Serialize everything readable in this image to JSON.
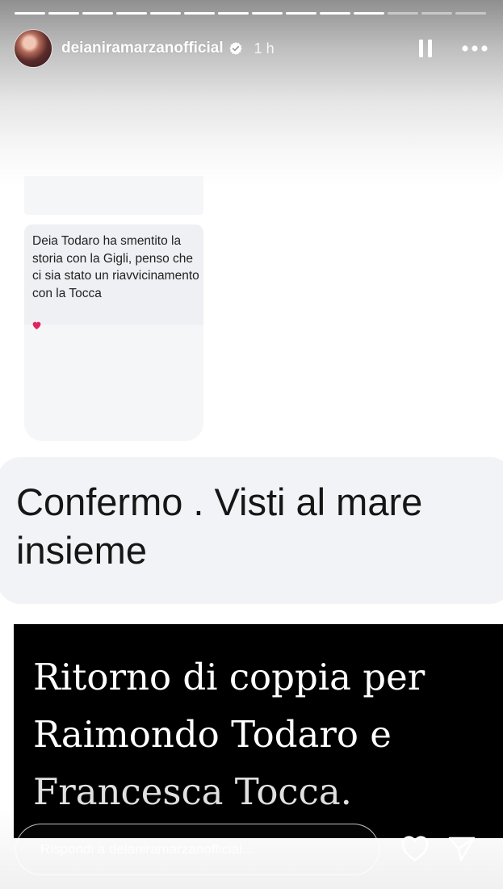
{
  "story": {
    "segments_total": 14,
    "segments_viewed": 11
  },
  "header": {
    "username": "deianiramarzanofficial",
    "time": "1 h"
  },
  "card": {
    "message": "Deia Todaro ha smentito la storia con la Gigli, penso che ci sia stato un riavvicinamento con la Tocca"
  },
  "reply_bubble": {
    "text": "Confermo . Visti al mare insieme"
  },
  "headline": {
    "lines": [
      "Ritorno di coppia per",
      "Raimondo Todaro e",
      "Francesca Tocca."
    ]
  },
  "footer": {
    "reply_placeholder": "Rispondi a deianiramarzanofficial..."
  },
  "colors": {
    "heart_red": "#e0245e",
    "headline_bg": "#000000"
  }
}
